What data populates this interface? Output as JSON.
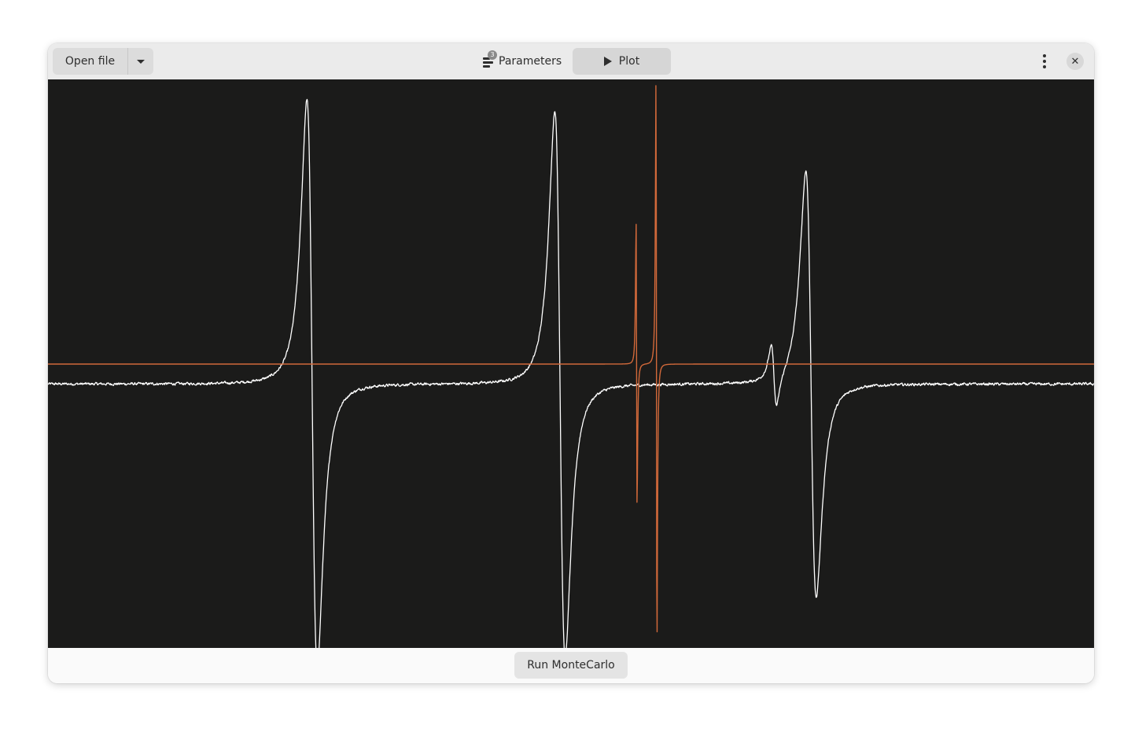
{
  "header": {
    "open_file_label": "Open file",
    "open_file_menu_icon": "pan-down-icon",
    "parameters_label": "Parameters",
    "parameters_badge": "3",
    "parameters_icon": "sliders-icon",
    "plot_label": "Plot",
    "plot_icon": "play-icon",
    "menu_icon": "view-more-icon",
    "close_icon": "close-icon",
    "close_glyph": "✕"
  },
  "footer": {
    "run_label": "Run MonteCarlo"
  },
  "colors": {
    "plot_background": "#1b1b1a",
    "experimental_trace": "#ffffff",
    "simulated_trace": "#d2693a"
  },
  "chart_data": {
    "type": "line",
    "title": "",
    "xlabel": "",
    "ylabel": "",
    "grid": false,
    "xlim": [
      0,
      1
    ],
    "ylim": [
      -1,
      1
    ],
    "series": [
      {
        "color": "#ffffff",
        "baseline": -0.07,
        "noise": 0.008,
        "lines": [
          {
            "center": 0.2525,
            "amplitude": 1.0,
            "width": 0.0086
          },
          {
            "center": 0.4895,
            "amplitude": 0.96,
            "width": 0.0086
          },
          {
            "center": 0.7295,
            "amplitude": 0.75,
            "width": 0.0086
          },
          {
            "center": 0.694,
            "amplitude": 0.11,
            "width": 0.0045
          }
        ]
      },
      {
        "color": "#d2693a",
        "baseline": 0.0,
        "noise": 0.0,
        "lines": [
          {
            "center": 0.5817,
            "amplitude": 1.0,
            "width": 0.0008
          },
          {
            "center": 0.5627,
            "amplitude": 0.5,
            "width": 0.0008
          }
        ]
      }
    ]
  }
}
